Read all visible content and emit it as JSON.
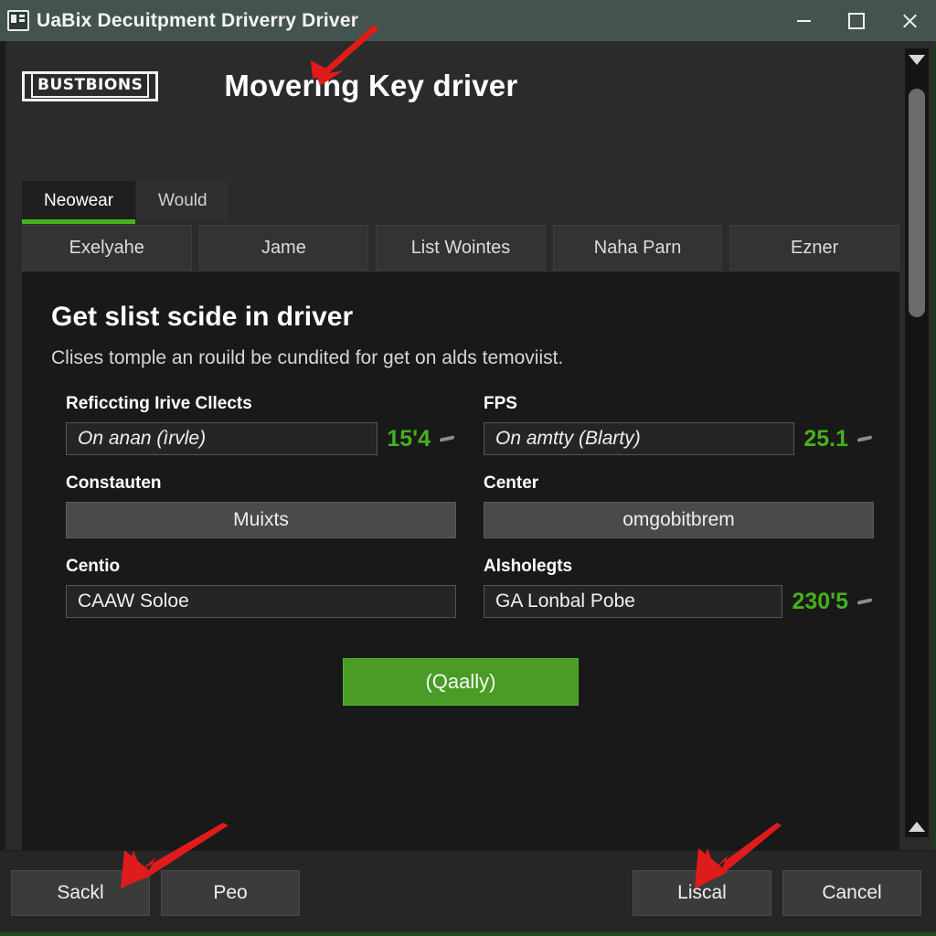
{
  "window": {
    "title": "UaBix Decuitpment Driverry Driver",
    "icon": "app-window-icon",
    "minimize_label": "",
    "maximize_label": "",
    "close_label": ""
  },
  "brand": {
    "logo_text": "BUSTBIONS",
    "headline": "Movering Key driver"
  },
  "tabs_primary": [
    {
      "label": "Neowear",
      "active": true
    },
    {
      "label": "Would",
      "active": false
    }
  ],
  "tabs_secondary": [
    {
      "label": "Exelyahe"
    },
    {
      "label": "Jame"
    },
    {
      "label": "List Wointes"
    },
    {
      "label": "Naha Parn"
    },
    {
      "label": "Ezner"
    }
  ],
  "content": {
    "section_title": "Get slist scide in driver",
    "section_subtitle": "Clises tomple an rouild be cundited for get on alds temoviist.",
    "fields": [
      {
        "label": "Reficcting Irive Cllects",
        "value": "On anan (ìrvle)",
        "metric": "15'4",
        "style": "input",
        "has_caret": true
      },
      {
        "label": "FPS",
        "value": "On amtty (Blarty)",
        "metric": "25.1",
        "style": "input",
        "has_caret": true
      },
      {
        "label": "Constauten",
        "value": "Muixts",
        "metric": "",
        "style": "center",
        "has_caret": false
      },
      {
        "label": "Center",
        "value": "omgobitbrem",
        "metric": "",
        "style": "center",
        "has_caret": false
      },
      {
        "label": "Centio",
        "value": "CAAW Soloe",
        "metric": "",
        "style": "plain",
        "has_caret": false
      },
      {
        "label": "Alsholegts",
        "value": "GA Lonbal Pobe",
        "metric": "230'5",
        "style": "plain",
        "has_caret": true
      }
    ],
    "cta_label": "(Qaally)"
  },
  "footer": {
    "left_buttons": [
      {
        "label": "Sackl"
      },
      {
        "label": "Peo"
      }
    ],
    "right_buttons": [
      {
        "label": "Liscal"
      },
      {
        "label": "Cancel"
      }
    ]
  },
  "scrollbar": {
    "up_arrow": "chevron-down-icon",
    "down_arrow": "chevron-up-icon"
  },
  "colors": {
    "titlebar": "#44534e",
    "accent_green": "#49b11e",
    "cta_green": "#4a9c27",
    "metric_green": "#46b01b",
    "panel_bg": "#191919",
    "window_bg": "#2b2b2b",
    "annotation_red": "#e01b1b"
  }
}
